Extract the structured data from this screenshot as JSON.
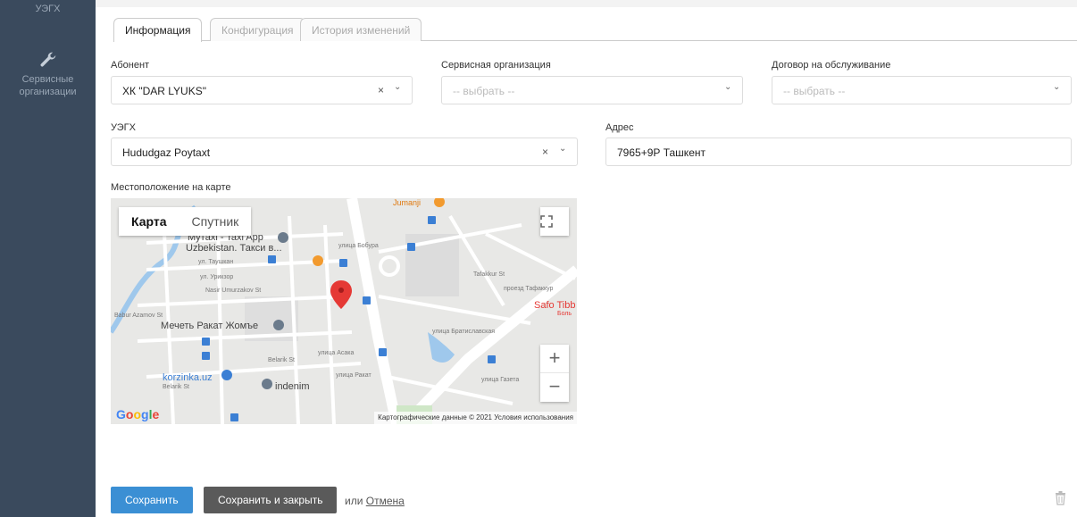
{
  "sidebar": {
    "top_label": "УЭГХ",
    "items": [
      {
        "label_line1": "Сервисные",
        "label_line2": "организации",
        "icon": "wrench-icon"
      }
    ]
  },
  "tabs": [
    {
      "label": "Информация",
      "active": true
    },
    {
      "label": "Конфигурация",
      "active": false
    },
    {
      "label": "История изменений",
      "active": false
    }
  ],
  "form": {
    "subscriber": {
      "label": "Абонент",
      "value": "ХК \"DAR LYUKS\""
    },
    "service_org": {
      "label": "Сервисная организация",
      "placeholder": "-- выбрать --"
    },
    "contract": {
      "label": "Договор на обслуживание",
      "placeholder": "-- выбрать --"
    },
    "uegh": {
      "label": "УЭГХ",
      "value": "Hududgaz Poytaxt"
    },
    "address": {
      "label": "Адрес",
      "value": "7965+9Р Ташкент"
    },
    "map_label": "Местоположение на карте",
    "clear_symbol": "×",
    "chevron_symbol": "⌄"
  },
  "map": {
    "type_map": "Карта",
    "type_satellite": "Спутник",
    "zoom_in": "+",
    "zoom_out": "−",
    "attribution": "Картографические данные © 2021   Условия использования",
    "google": "Google",
    "places": {
      "taxi1": "Мyтaxi - Taxi App",
      "taxi2": "Uzbekistan. Такси в...",
      "mosque": "Мечеть Ракат Жомъе",
      "korzinka": "korzinka.uz",
      "indenim": "indenim",
      "safo1": "Safo Tibb",
      "safo2": "Боль",
      "jumanji": "Jumanji",
      "street_bobur": "улица Бобура",
      "street_nasir": "Nasir Umurzakov St",
      "street_uriksor": "ул. Урикзор",
      "street_taushkan": "ул. Таушкан",
      "street_belarik": "Belarik St",
      "street_belarik2": "Belarik St",
      "street_asaka": "улица Асака",
      "street_rakat": "улица Ракат",
      "street_bratislava": "улица Братиславская",
      "street_tafakkur": "Tafakkur St",
      "street_tafakkur2": "проезд Тафаккур",
      "street_azamov": "Babur Azamov St",
      "street_gazeta": "улица Газета"
    }
  },
  "actions": {
    "save": "Сохранить",
    "save_close": "Сохранить и закрыть",
    "or": "или",
    "cancel": "Отмена"
  },
  "colors": {
    "sidebar_bg": "#3a4a5d",
    "primary": "#3b8fd4",
    "secondary": "#5a5a5a",
    "marker": "#e53935"
  }
}
